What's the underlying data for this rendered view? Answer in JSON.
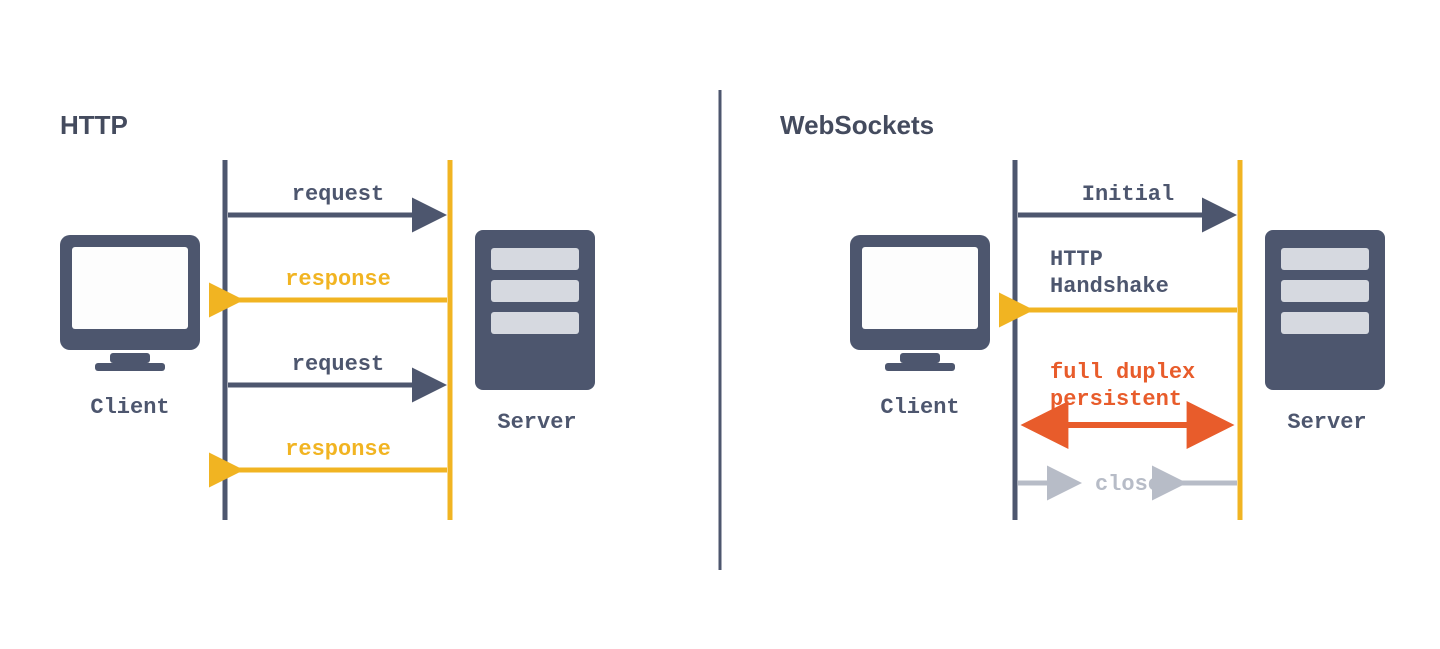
{
  "left": {
    "title": "HTTP",
    "client_label": "Client",
    "server_label": "Server",
    "arrows": [
      {
        "text": "request",
        "color": "#4d566e"
      },
      {
        "text": "response",
        "color": "#f1b422"
      },
      {
        "text": "request",
        "color": "#4d566e"
      },
      {
        "text": "response",
        "color": "#f1b422"
      }
    ]
  },
  "right": {
    "title": "WebSockets",
    "client_label": "Client",
    "server_label": "Server",
    "initial": "Initial",
    "handshake_l1": "HTTP",
    "handshake_l2": "Handshake",
    "duplex_l1": "full duplex",
    "duplex_l2": "persistent",
    "close": "close"
  },
  "colors": {
    "slate": "#4d566e",
    "amber": "#f1b422",
    "orange": "#e85c2b",
    "grey": "#b7bcc7",
    "screen": "#fdfdfd",
    "inner": "#d6d9e0"
  }
}
